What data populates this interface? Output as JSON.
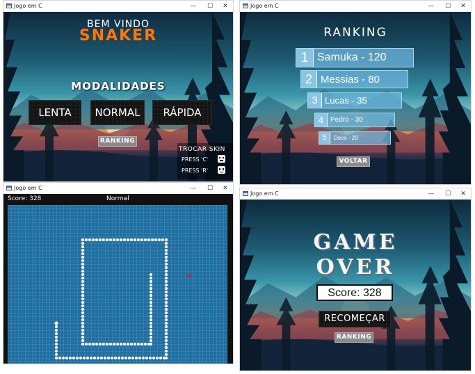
{
  "window_title": "Jogo em C",
  "controls": {
    "minimize": "—",
    "maximize": "☐",
    "close": "✕"
  },
  "menu": {
    "welcome": "BEM VINDO",
    "game_name": "SNAKER",
    "modes_title": "MODALIDADES",
    "modes": [
      "LENTA",
      "NORMAL",
      "RÁPIDA"
    ],
    "ranking_button": "RANKING",
    "skin": {
      "title": "TROCAR SKIN",
      "press_c": "PRESS 'C'",
      "press_r": "PRESS 'R'"
    }
  },
  "ranking": {
    "title": "RANKING",
    "entries": [
      {
        "pos": "1",
        "text": "Samuka - 120"
      },
      {
        "pos": "2",
        "text": "Messias - 80"
      },
      {
        "pos": "3",
        "text": "Lucas - 35"
      },
      {
        "pos": "4",
        "text": "Pedro - 30"
      },
      {
        "pos": "5",
        "text": "Deco - 20"
      }
    ],
    "back_button": "VOLTAR"
  },
  "gameplay": {
    "score_label": "Score: 328",
    "mode_label": "Normal",
    "colors": {
      "board": "#1d6ea1",
      "snake": "#ffffff",
      "food": "#d0202a"
    }
  },
  "gameover": {
    "title_line1": "GAME",
    "title_line2": "OVER",
    "score_label": "Score: 328",
    "restart_button": "RECOMEÇAR",
    "ranking_button": "RANKING"
  }
}
